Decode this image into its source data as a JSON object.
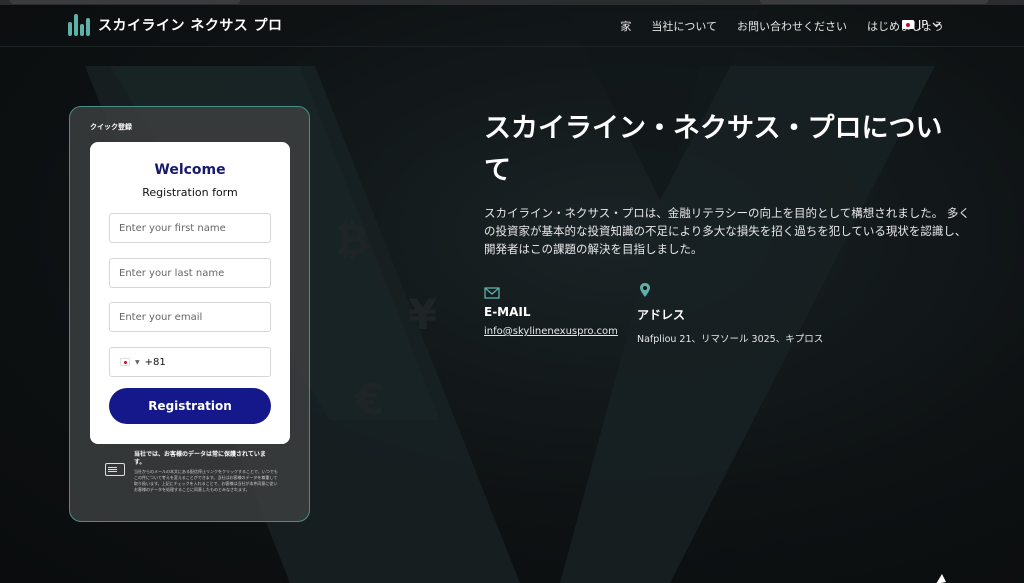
{
  "header": {
    "brand": "スカイライン ネクサス プロ",
    "nav": [
      "家",
      "当社について",
      "お問い合わせください",
      "はじめましょう"
    ],
    "language": "JP"
  },
  "quick_register": {
    "section_label": "クイック登録",
    "welcome": "Welcome",
    "subtitle": "Registration form",
    "first_name_placeholder": "Enter your first name",
    "last_name_placeholder": "Enter your last name",
    "email_placeholder": "Enter your email",
    "phone_code": "+81",
    "submit_label": "Registration",
    "privacy_title": "当社では、お客様のデータは常に保護されています。",
    "privacy_text": "当社からのメールの本文にある配信停止リンクをクリックすることで、いつでもこの件について考えを変えることができます。当社はお客様のデータを尊重して取り扱います。上記にチェックを入れることで、お客様は当社が本件同意に従いお客様のデータを処理することに同意したものとみなされます。"
  },
  "about": {
    "title": "スカイライン・ネクサス・プロについて",
    "text": "スカイライン・ネクサス・プロは、金融リテラシーの向上を目的として構想されました。 多くの投資家が基本的な投資知識の不足により多大な損失を招く過ちを犯している現状を認識し、開発者はこの課題の解決を目指しました。"
  },
  "contact": {
    "email_label": "E-MAIL",
    "email": "info@skylinenexuspro.com",
    "address_label": "アドレス",
    "address": "Nafpliou 21、リマソール 3025、キプロス"
  },
  "colors": {
    "accent": "#5fb0a8",
    "button": "#14188a",
    "welcome": "#161a6e"
  }
}
